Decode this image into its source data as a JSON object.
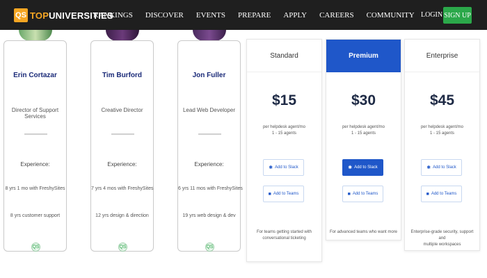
{
  "nav": {
    "logo_badge": "QS",
    "logo_top": "TOP",
    "logo_rest": "UNIVERSITIES",
    "links": [
      "RANKINGS",
      "DISCOVER",
      "EVENTS",
      "PREPARE",
      "APPLY",
      "CAREERS",
      "COMMUNITY"
    ],
    "login": "LOGIN",
    "signup": "SIGN UP"
  },
  "team": [
    {
      "name": "Erin Cortazar",
      "role": "Director of Support Services",
      "experience_label": "Experience:",
      "exp1": "8 yrs 1 mo with FreshySites",
      "exp2": "8 yrs customer support"
    },
    {
      "name": "Tim Burford",
      "role": "Creative Director",
      "experience_label": "Experience:",
      "exp1": "7 yrs 4 mos with FreshySites",
      "exp2": "12 yrs design & direction"
    },
    {
      "name": "Jon Fuller",
      "role": "Lead Web Developer",
      "experience_label": "Experience:",
      "exp1": "6 yrs 11 mos with FreshySites",
      "exp2": "19 yrs web design & dev"
    }
  ],
  "pricing": [
    {
      "plan": "Standard",
      "price": "$15",
      "desc1": "per helpdesk agent/mo",
      "desc2": "1 - 15 agents",
      "slack_label": "Add to Slack",
      "teams_label": "Add to Teams",
      "footer1": "For teams getting started with",
      "footer2": "conversational ticketing"
    },
    {
      "plan": "Premium",
      "price": "$30",
      "desc1": "per helpdesk agent/mo",
      "desc2": "1 - 15 agents",
      "slack_label": "Add to Slack",
      "teams_label": "Add to Teams",
      "footer1": "For advanced teams who want more",
      "footer2": ""
    },
    {
      "plan": "Enterprise",
      "price": "$45",
      "desc1": "per helpdesk agent/mo",
      "desc2": "1 - 15 agents",
      "slack_label": "Add to Slack",
      "teams_label": "Add to Teams",
      "footer1": "Enterprise-grade security, support and",
      "footer2": "multiple workspaces"
    }
  ],
  "colors": {
    "nav_bg": "#1f1f1f",
    "brand_orange": "#f5a623",
    "signup_green": "#2ba84a",
    "premium_blue": "#1f57c9",
    "name_navy": "#1a2a78"
  },
  "icons": {
    "slack": "slack-icon",
    "teams": "teams-icon",
    "team_badge": "qs-badge-icon"
  }
}
